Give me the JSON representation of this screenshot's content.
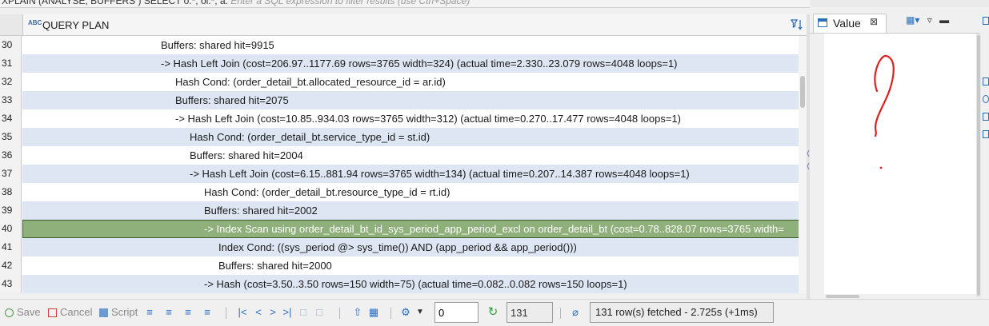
{
  "filter_bar": {
    "query_text": "XPLAIN (ANALYSE, BUFFERS ) SELECT o.*, ol.*, a.",
    "placeholder": "Enter a SQL expression to filter results (use Ctrl+Space)"
  },
  "grid": {
    "column_header": "QUERY PLAN",
    "rows": [
      {
        "num": "30",
        "text": "Buffers: shared hit=9915",
        "indent": 8,
        "style": "plain"
      },
      {
        "num": "31",
        "text": "->  Hash Left Join  (cost=206.97..1177.69 rows=3765 width=324) (actual time=2.330..23.079 rows=4048 loops=1)",
        "indent": 8,
        "style": "alt"
      },
      {
        "num": "32",
        "text": "Hash Cond: (order_detail_bt.allocated_resource_id = ar.id)",
        "indent": 9,
        "style": "plain"
      },
      {
        "num": "33",
        "text": "Buffers: shared hit=2075",
        "indent": 9,
        "style": "alt"
      },
      {
        "num": "34",
        "text": "->  Hash Left Join  (cost=10.85..934.03 rows=3765 width=312) (actual time=0.270..17.477 rows=4048 loops=1)",
        "indent": 9,
        "style": "plain"
      },
      {
        "num": "35",
        "text": "Hash Cond: (order_detail_bt.service_type_id = st.id)",
        "indent": 10,
        "style": "alt"
      },
      {
        "num": "36",
        "text": "Buffers: shared hit=2004",
        "indent": 10,
        "style": "plain"
      },
      {
        "num": "37",
        "text": "->  Hash Left Join  (cost=6.15..881.94 rows=3765 width=134) (actual time=0.207..14.387 rows=4048 loops=1)",
        "indent": 10,
        "style": "alt"
      },
      {
        "num": "38",
        "text": "Hash Cond: (order_detail_bt.resource_type_id = rt.id)",
        "indent": 11,
        "style": "plain"
      },
      {
        "num": "39",
        "text": "Buffers: shared hit=2002",
        "indent": 11,
        "style": "alt"
      },
      {
        "num": "40",
        "text": "->  Index Scan using order_detail_bt_id_sys_period_app_period_excl on order_detail_bt  (cost=0.78..828.07 rows=3765 width=",
        "indent": 11,
        "style": "sel"
      },
      {
        "num": "41",
        "text": "Index Cond: ((sys_period @> sys_time()) AND (app_period && app_period()))",
        "indent": 12,
        "style": "alt"
      },
      {
        "num": "42",
        "text": "Buffers: shared hit=2000",
        "indent": 12,
        "style": "plain"
      },
      {
        "num": "43",
        "text": "->  Hash  (cost=3.50..3.50 rows=150 width=75) (actual time=0.082..0.082 rows=150 loops=1)",
        "indent": 11,
        "style": "alt"
      },
      {
        "num": "",
        "text": "",
        "indent": 12,
        "style": "plain"
      }
    ]
  },
  "value_panel": {
    "tab_label": "Value",
    "content": "?"
  },
  "bottom_bar": {
    "save_label": "Save",
    "cancel_label": "Cancel",
    "script_label": "Script",
    "fetch_size_value": "0",
    "row_count_value": "131",
    "status_text": "131 row(s) fetched - 2.725s (+1ms)"
  },
  "colors": {
    "row_alt": "#dde6f2",
    "row_selected": "#8fb07a",
    "accent": "#2a6ebb",
    "handwriting": "#e02020"
  }
}
